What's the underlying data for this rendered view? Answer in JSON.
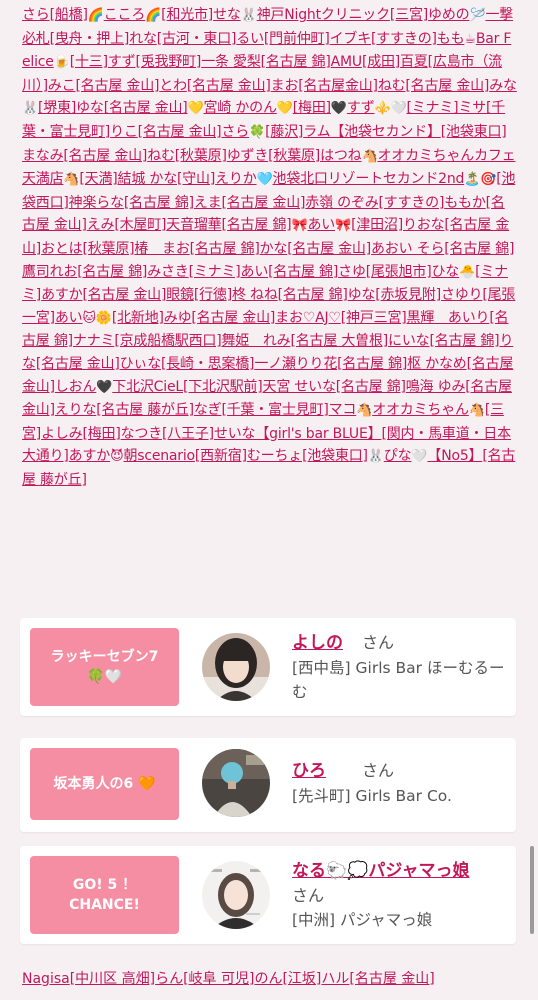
{
  "name_cloud": [
    "さら",
    "[船橋]",
    "🌈",
    "こころ",
    "🌈",
    "[和光市]",
    "せな",
    "🐰",
    "神戸Nightクリニック",
    "[三宮]",
    "ゆめの",
    "🪡",
    "一撃必札",
    "[曳舟・押上]",
    "れな",
    "[古河・東口]",
    "るい",
    "[門前仲町]",
    "イブキ",
    "[すすき",
    "の]",
    "もも",
    "☕",
    "Bar Felice",
    "🍺",
    "[十三]",
    "すず",
    "[兎我野町]",
    "一条 愛梨",
    "[名古屋 錦]",
    "AMU",
    "[成",
    "田]",
    "百夏",
    "[広島市（流川）]",
    "みこ",
    "[名古屋 金山]",
    "とわ",
    "[名古屋 金山]",
    "まお",
    "[名古屋",
    "金山]",
    "ねむ",
    "[名古屋 金山]",
    "みな",
    "🐰",
    "[堺東]",
    "ゆな",
    "[名古屋 金山]",
    "💛",
    "宮崎 かのん",
    "💛",
    "[梅田]",
    "🖤",
    "すず",
    "⚜️",
    "🤍",
    "[ミナミ]",
    "ミサ",
    "[千葉・富士見町]",
    "りこ",
    "[名古屋 金山]",
    "さら",
    "🍀",
    "[藤沢]",
    "ラム【池袋セカンド】",
    "[池袋東口]",
    "まなみ",
    "[名古屋 金山]",
    "ねむ",
    "[秋葉",
    "原]",
    "ゆずき",
    "[秋葉原]",
    "はつね",
    "🐴",
    "オオカミちゃんカフェ天満店",
    "🐴",
    "[天満]",
    "結城 か",
    "な",
    "[守山]",
    "えりか",
    "🩵",
    "池袋北口リゾートセカンド2nd",
    "🏝️",
    "🎯",
    "[池袋西口]",
    "神楽ら",
    "な",
    "[名古屋 錦]",
    "えま",
    "[名古屋 金山]",
    "赤嶺 のぞみ",
    "[すすきの]",
    "ももか",
    "[名古屋 金山]",
    "えみ",
    "[木屋町]",
    "天音瑠華",
    "[名古屋 錦]",
    "🎀",
    "あい",
    "🎀",
    "[津田沼]",
    "りおな",
    "[名古屋 金山]",
    "お",
    "とは",
    "[秋葉原]",
    "椿　まお",
    "[名古屋 錦]",
    "かな",
    "[名古屋 金山]",
    "あおい そら",
    "[名古屋 錦]",
    "鷹司れお",
    "[名古屋 錦]",
    "みさき",
    "[ミナミ]",
    "あい",
    "[名古屋 錦]",
    "さゆ",
    "[尾張旭市]",
    "ひな",
    "🐣",
    "[ミナミ]",
    "あすか",
    "[名古屋 金山]",
    "眼鏡",
    "[行徳]",
    "柊 ねね",
    "[名古屋 錦]",
    "ゆな",
    "[赤坂見附]",
    "さゆり",
    "[尾張 一宮]",
    "あい",
    "🐱",
    "🌼",
    "[北新地]",
    "みゆ",
    "[名古屋 金山]",
    "まお♡AJ♡",
    "[神戸三",
    "宮]",
    "黒輝　あいり",
    "[名古屋 錦]",
    "ナナミ",
    "[京成船橋駅西口]",
    "舞姫　れみ",
    "[名古屋 大",
    "曽根]",
    "にいな",
    "[名古屋 錦]",
    "りな",
    "[名古屋 金山]",
    "ひぃな",
    "[長崎・思案橋]",
    "一ノ瀬りり",
    "花",
    "[名古屋 錦]",
    "枢 かなめ",
    "[名古屋 金山]",
    "しおん",
    "🖤",
    "下北沢CieL",
    "[下北沢駅前]",
    "天",
    "宮 せいな",
    "[名古屋 錦]",
    "鳴海 ゆみ",
    "[名古屋 金山]",
    "えりな",
    "[名古屋 藤が丘]",
    "なぎ",
    "[千",
    "葉・富士見町]",
    "マコ",
    "🐴",
    "オオカミちゃん",
    "🐴",
    "[三宮]",
    "よしみ",
    "[梅田]",
    "なつき",
    "[八王",
    "子]",
    "せいな【girl's bar BLUE】",
    "[関内・馬車道・日本大通り]",
    "あすか",
    "😈",
    "朝",
    "scenario",
    "[西新宿]",
    "むーちょ",
    "[池袋東口]",
    "🐰",
    "ぴな",
    "🤍",
    "【No5】",
    "[名古屋 藤が丘]"
  ],
  "ranking_cards": [
    {
      "badge_lines": [
        "ラッキーセブン7",
        "🍀🤍"
      ],
      "name": "よしの",
      "honorific": "さん",
      "shop": "[西中島] Girls Bar ほーむるーむ"
    },
    {
      "badge_lines": [
        "坂本勇人の6 🧡"
      ],
      "name": "ひろ",
      "honorific": "さん",
      "shop": "[先斗町] Girls Bar Co."
    },
    {
      "badge_lines": [
        "GO! 5 ！",
        "CHANCE!"
      ],
      "name": "なる🐑💭パジャマっ娘",
      "honorific": "さん",
      "shop": "[中洲] パジャマっ娘"
    }
  ],
  "footer_line": [
    "Nagisa",
    "[中川区 高畑]",
    "らん",
    "[岐阜 可児]",
    "のん",
    "[江坂]",
    "ハル",
    "[名古屋 金山]"
  ],
  "colors": {
    "link": "#c2185b",
    "badge": "#f58ea3",
    "background": "#f6f0f2"
  },
  "icons": {
    "avatar_1": "woman-portrait-avatar",
    "avatar_2": "person-with-blurred-face-avatar",
    "avatar_3": "woman-portrait-with-name-logo-avatar"
  }
}
